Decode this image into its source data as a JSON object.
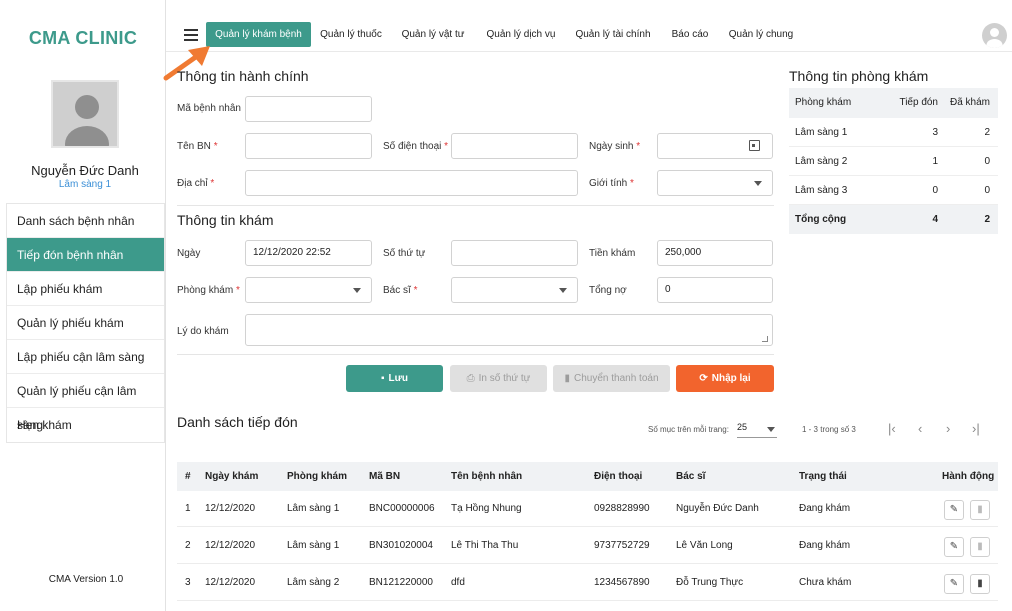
{
  "brand": "CMA CLINIC",
  "user": {
    "name": "Nguyễn Đức Danh",
    "room": "Lâm sàng 1"
  },
  "sidebar": {
    "items": [
      {
        "label": "Danh sách bệnh nhân",
        "active": false
      },
      {
        "label": "Tiếp đón bệnh nhân",
        "active": true
      },
      {
        "label": "Lập phiếu khám",
        "active": false
      },
      {
        "label": "Quản lý phiếu khám",
        "active": false
      },
      {
        "label": "Lập phiếu cận lâm sàng",
        "active": false
      },
      {
        "label": "Quản lý phiếu cận lâm sàng",
        "active": false
      },
      {
        "label": "Hẹn khám",
        "active": false
      }
    ],
    "version": "CMA Version 1.0"
  },
  "nav": {
    "tabs": [
      {
        "label": "Quản lý khám bệnh"
      },
      {
        "label": "Quản lý thuốc"
      },
      {
        "label": "Quản lý vật tư"
      },
      {
        "label": "Quản lý dịch vụ"
      },
      {
        "label": "Quản lý tài chính"
      },
      {
        "label": "Báo cáo"
      },
      {
        "label": "Quản lý chung"
      }
    ],
    "active_tab": "Quản lý khám bệnh"
  },
  "admin": {
    "title": "Thông tin hành chính",
    "patient_id_label": "Mã bệnh nhân",
    "patient_name_label": "Tên BN",
    "phone_label": "Số điện thoại",
    "dob_label": "Ngày sinh",
    "address_label": "Địa chỉ",
    "gender_label": "Giới tính",
    "required_mark": "*"
  },
  "exam": {
    "title": "Thông tin khám",
    "date_label": "Ngày",
    "date_value": "12/12/2020 22:52",
    "order_label": "Số thứ tự",
    "fee_label": "Tiền khám",
    "fee_value": "250,000",
    "room_label": "Phòng khám",
    "doctor_label": "Bác sĩ",
    "debt_label": "Tổng nợ",
    "debt_value": "0",
    "reason_label": "Lý do khám"
  },
  "buttons": {
    "save": "Lưu",
    "print_order": "In số thứ tự",
    "transfer": "Chuyển thanh toán",
    "reset": "Nhập lại"
  },
  "clinic_info": {
    "title": "Thông tin phòng khám",
    "headers": [
      "Phòng khám",
      "Tiếp đón",
      "Đã khám"
    ],
    "rows": [
      {
        "room": "Lâm sàng 1",
        "received": "3",
        "examined": "2"
      },
      {
        "room": "Lâm sàng 2",
        "received": "1",
        "examined": "0"
      },
      {
        "room": "Lâm sàng 3",
        "received": "0",
        "examined": "0"
      }
    ],
    "total": {
      "room": "Tổng cộng",
      "received": "4",
      "examined": "2"
    }
  },
  "reception": {
    "title": "Danh sách tiếp đón",
    "per_page_label": "Số mục trên mỗi trang:",
    "per_page_value": "25",
    "range_label": "1 - 3 trong số 3",
    "headers": [
      "#",
      "Ngày khám",
      "Phòng khám",
      "Mã BN",
      "Tên bệnh nhân",
      "Điện thoại",
      "Bác sĩ",
      "Trạng thái",
      "Hành động"
    ],
    "rows": [
      {
        "no": "1",
        "date": "12/12/2020",
        "room": "Lâm sàng 1",
        "code": "BNC00000006",
        "name": "Tạ Hồng Nhung",
        "phone": "0928828990",
        "doctor": "Nguyễn Đức Danh",
        "status": "Đang khám",
        "can_delete": false
      },
      {
        "no": "2",
        "date": "12/12/2020",
        "room": "Lâm sàng 1",
        "code": "BN301020004",
        "name": "Lê Thi Tha Thu",
        "phone": "9737752729",
        "doctor": "Lê Văn Long",
        "status": "Đang khám",
        "can_delete": false
      },
      {
        "no": "3",
        "date": "12/12/2020",
        "room": "Lâm sàng 2",
        "code": "BN121220000",
        "name": "dfd",
        "phone": "1234567890",
        "doctor": "Đỗ Trung Thực",
        "status": "Chưa khám",
        "can_delete": true
      }
    ]
  },
  "colors": {
    "accent": "#3d9a8b",
    "reset": "#f2642d",
    "arrow": "#f07a32",
    "link": "#3b8fd6"
  }
}
